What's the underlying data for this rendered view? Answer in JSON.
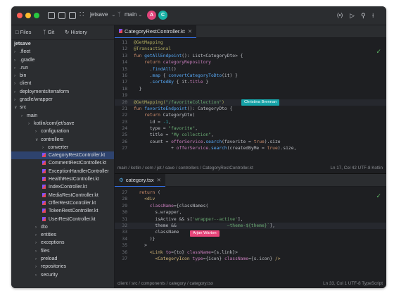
{
  "titlebar": {
    "project": "jetsave",
    "branch": "main",
    "avatar_a": "A",
    "avatar_c": "C"
  },
  "sidebar": {
    "tabs": [
      "Files",
      "Git",
      "History"
    ],
    "tree": [
      {
        "label": "jetsave",
        "depth": 0,
        "arrow": "",
        "bold": true
      },
      {
        "label": ".fleet",
        "depth": 0,
        "arrow": ">"
      },
      {
        "label": ".gradle",
        "depth": 0,
        "arrow": ">"
      },
      {
        "label": ".run",
        "depth": 0,
        "arrow": ">"
      },
      {
        "label": "bin",
        "depth": 0,
        "arrow": ">"
      },
      {
        "label": "client",
        "depth": 0,
        "arrow": ">"
      },
      {
        "label": "deployments/terraform",
        "depth": 0,
        "arrow": ">"
      },
      {
        "label": "gradle/wrapper",
        "depth": 0,
        "arrow": ">"
      },
      {
        "label": "src",
        "depth": 0,
        "arrow": "v"
      },
      {
        "label": "main",
        "depth": 1,
        "arrow": ">"
      },
      {
        "label": "kotlin/com/jet/save",
        "depth": 2,
        "arrow": ">"
      },
      {
        "label": "configuration",
        "depth": 3,
        "arrow": ">"
      },
      {
        "label": "controllers",
        "depth": 3,
        "arrow": "v"
      },
      {
        "label": "converter",
        "depth": 4,
        "arrow": ">"
      },
      {
        "label": "CategoryRestController.kt",
        "depth": 4,
        "kt": true,
        "selected": true
      },
      {
        "label": "CommentRestController.kt",
        "depth": 4,
        "kt": true
      },
      {
        "label": "ExceptionHandlerController",
        "depth": 4,
        "kt": true
      },
      {
        "label": "HealthRestController.kt",
        "depth": 4,
        "kt": true
      },
      {
        "label": "IndexController.kt",
        "depth": 4,
        "kt": true
      },
      {
        "label": "MediaRestController.kt",
        "depth": 4,
        "kt": true
      },
      {
        "label": "OfferRestController.kt",
        "depth": 4,
        "kt": true
      },
      {
        "label": "TokenRestController.kt",
        "depth": 4,
        "kt": true
      },
      {
        "label": "UserRestController.kt",
        "depth": 4,
        "kt": true
      },
      {
        "label": "dto",
        "depth": 3,
        "arrow": ">"
      },
      {
        "label": "entities",
        "depth": 3,
        "arrow": ">"
      },
      {
        "label": "exceptions",
        "depth": 3,
        "arrow": ">"
      },
      {
        "label": "files",
        "depth": 3,
        "arrow": ">"
      },
      {
        "label": "preload",
        "depth": 3,
        "arrow": ">"
      },
      {
        "label": "repositories",
        "depth": 3,
        "arrow": ">"
      },
      {
        "label": "security",
        "depth": 3,
        "arrow": ">"
      }
    ]
  },
  "editor_top": {
    "tab_label": "CategoryRestController.kt",
    "collaborator": "Christina Brennan",
    "collaborator_color": "#16a3a8",
    "status_path": "main / kotlin / com / jet / save / controllers / CategoryRestController.kt",
    "status_info": "Ln 17, Col 42   UTF-8   Kotlin",
    "lines": [
      {
        "n": "11",
        "t": [
          [
            "an",
            "@GetMapping"
          ]
        ]
      },
      {
        "n": "12",
        "t": [
          [
            "an",
            "@Transactional"
          ]
        ]
      },
      {
        "n": "13",
        "t": [
          [
            "kw",
            "fun "
          ],
          [
            "fn",
            "getAllEndpoint"
          ],
          [
            "",
            "(): List<CategoryDto> {"
          ]
        ]
      },
      {
        "n": "14",
        "t": [
          [
            "",
            "    "
          ],
          [
            "kw",
            "return "
          ],
          [
            "pr",
            "categoryRepository"
          ]
        ]
      },
      {
        "n": "15",
        "t": [
          [
            "",
            "      ."
          ],
          [
            "fn",
            "findAll"
          ],
          [
            "",
            "()"
          ]
        ]
      },
      {
        "n": "16",
        "t": [
          [
            "",
            "      ."
          ],
          [
            "fn",
            "map"
          ],
          [
            "",
            " { "
          ],
          [
            "fn",
            "convertCategoryToDto"
          ],
          [
            "",
            "(it) }"
          ]
        ]
      },
      {
        "n": "17",
        "t": [
          [
            "",
            "      ."
          ],
          [
            "fn",
            "sortedBy"
          ],
          [
            "",
            " { it."
          ],
          [
            "pr",
            "title"
          ],
          [
            "",
            " }"
          ]
        ]
      },
      {
        "n": "18",
        "t": [
          [
            "",
            "  }"
          ]
        ]
      },
      {
        "n": "19",
        "t": [
          [
            "",
            ""
          ]
        ]
      },
      {
        "n": "20",
        "t": [
          [
            "an",
            "@GetMapping("
          ],
          [
            "st",
            "\"/favoriteCollection\""
          ],
          [
            "an",
            ")"
          ]
        ],
        "hl": true
      },
      {
        "n": "21",
        "t": [
          [
            "kw",
            "fun "
          ],
          [
            "fn",
            "favoriteEndpoint"
          ],
          [
            "",
            "(): CategoryDto {"
          ]
        ]
      },
      {
        "n": "22",
        "t": [
          [
            "",
            "    "
          ],
          [
            "kw",
            "return "
          ],
          [
            "",
            "CategoryDto("
          ]
        ]
      },
      {
        "n": "23",
        "t": [
          [
            "",
            "      id = "
          ],
          [
            "nm",
            "-1"
          ],
          [
            "",
            ","
          ]
        ]
      },
      {
        "n": "24",
        "t": [
          [
            "",
            "      type = "
          ],
          [
            "st",
            "\"favorite\""
          ],
          [
            "",
            ","
          ]
        ]
      },
      {
        "n": "25",
        "t": [
          [
            "",
            "      title = "
          ],
          [
            "st",
            "\"My collection\""
          ],
          [
            "",
            ","
          ]
        ]
      },
      {
        "n": "26",
        "t": [
          [
            "",
            "      count = "
          ],
          [
            "pr",
            "offerService"
          ],
          [
            "",
            "."
          ],
          [
            "fn",
            "search"
          ],
          [
            "",
            "(favorite = "
          ],
          [
            "kw",
            "true"
          ],
          [
            "",
            ").size"
          ]
        ]
      },
      {
        "n": "27",
        "t": [
          [
            "",
            "              + "
          ],
          [
            "pr",
            "offerService"
          ],
          [
            "",
            "."
          ],
          [
            "fn",
            "search"
          ],
          [
            "",
            "(createdByMe = "
          ],
          [
            "kw",
            "true"
          ],
          [
            "",
            ").size,"
          ]
        ]
      }
    ]
  },
  "editor_bottom": {
    "tab_label": "category.tsx",
    "collaborator": "Arjan Warton",
    "collaborator_color": "#e8457a",
    "status_path": "client / src / components / category / category.tsx",
    "status_info": "Ln 33, Col 1   UTF-8   TypeScript",
    "lines": [
      {
        "n": "27",
        "t": [
          [
            "",
            "  "
          ],
          [
            "kw",
            "return "
          ],
          [
            "",
            "("
          ]
        ]
      },
      {
        "n": "28",
        "t": [
          [
            "",
            "    "
          ],
          [
            "tg",
            "<div"
          ]
        ]
      },
      {
        "n": "29",
        "t": [
          [
            "",
            "      "
          ],
          [
            "pr",
            "className"
          ],
          [
            "",
            "={classNames("
          ]
        ]
      },
      {
        "n": "30",
        "t": [
          [
            "",
            "        s.wrapper,"
          ]
        ]
      },
      {
        "n": "31",
        "t": [
          [
            "",
            "        isActive && s["
          ],
          [
            "st",
            "'wrapper--active'"
          ],
          [
            "",
            "],"
          ]
        ]
      },
      {
        "n": "32",
        "t": [
          [
            "",
            "        theme && "
          ],
          [
            "st",
            "                  —theme-${theme}`"
          ],
          [
            "",
            "],"
          ]
        ],
        "hl": true
      },
      {
        "n": "33",
        "t": [
          [
            "",
            "        className"
          ]
        ]
      },
      {
        "n": "34",
        "t": [
          [
            "",
            "      )}"
          ]
        ]
      },
      {
        "n": "35",
        "t": [
          [
            "",
            "    >"
          ]
        ]
      },
      {
        "n": "36",
        "t": [
          [
            "",
            "      "
          ],
          [
            "tg",
            "<Link "
          ],
          [
            "pr",
            "to"
          ],
          [
            "",
            "={to} "
          ],
          [
            "pr",
            "className"
          ],
          [
            "",
            "={s.link}>"
          ]
        ]
      },
      {
        "n": "37",
        "t": [
          [
            "",
            "        "
          ],
          [
            "tg",
            "<CategoryIcon "
          ],
          [
            "pr",
            "type"
          ],
          [
            "",
            "={icon} "
          ],
          [
            "pr",
            "className"
          ],
          [
            "",
            "={s.icon} "
          ],
          [
            "tg",
            "/>"
          ]
        ]
      }
    ]
  }
}
